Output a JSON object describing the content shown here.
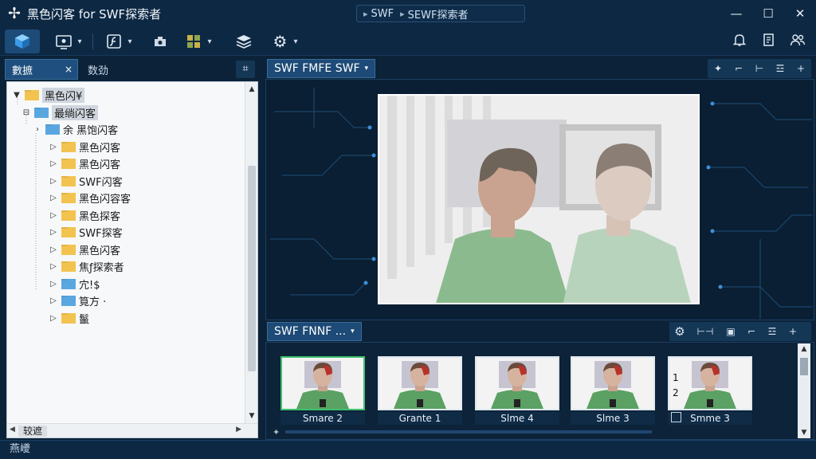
{
  "app": {
    "title": "黑色闪客 for SWF探索者"
  },
  "breadcrumb": {
    "items": [
      "SWF",
      "SEWF探索者"
    ]
  },
  "window_controls": [
    "minimize-icon",
    "maximize-icon",
    "close-icon"
  ],
  "toolbar": {
    "buttons": [
      "cube-icon",
      "screen-capture-icon",
      "flash-file-icon",
      "plugin-icon",
      "grid-icon",
      "layers-icon",
      "gear-icon"
    ],
    "right_buttons": [
      "bell-icon",
      "document-icon",
      "users-icon"
    ]
  },
  "left_panel": {
    "tabs": [
      {
        "label": "數摭",
        "close": "×"
      },
      {
        "label": "数劲"
      }
    ],
    "pin_label": "⌗",
    "tree": [
      {
        "label": "黑色闪¥",
        "depth": 0,
        "toggle": "▼",
        "folder": "yellow",
        "selected": true
      },
      {
        "label": "最绱闪客",
        "depth": 1,
        "toggle": "⊟",
        "folder": "blue",
        "selected": true
      },
      {
        "label": "余 黑饱闪客",
        "depth": 2,
        "toggle": "›",
        "folder": "blue"
      },
      {
        "label": "黑色闪客",
        "depth": 3,
        "toggle": "▷",
        "folder": "yellow"
      },
      {
        "label": "黑色闪客",
        "depth": 3,
        "toggle": "▷",
        "folder": "yellow"
      },
      {
        "label": "SWF闪客",
        "depth": 3,
        "toggle": "▷",
        "folder": "yellow"
      },
      {
        "label": "黑色闪容客",
        "depth": 3,
        "toggle": "▷",
        "folder": "yellow"
      },
      {
        "label": "黑色探客",
        "depth": 3,
        "toggle": "▷",
        "folder": "yellow"
      },
      {
        "label": "SWF探客",
        "depth": 3,
        "toggle": "▷",
        "folder": "yellow"
      },
      {
        "label": "黑色闪客",
        "depth": 3,
        "toggle": "▷",
        "folder": "yellow"
      },
      {
        "label": "焦ƒ探索者",
        "depth": 3,
        "toggle": "▷",
        "folder": "yellow"
      },
      {
        "label": "宂!$",
        "depth": 3,
        "toggle": "▷",
        "folder": "blue"
      },
      {
        "label": "筧方 ·",
        "depth": 3,
        "toggle": "▷",
        "folder": "blue"
      },
      {
        "label": "鬣",
        "depth": 3,
        "toggle": "▷",
        "folder": "yellow"
      }
    ],
    "bottom_chip": "较遮"
  },
  "preview_panel": {
    "tab_label": "SWF FMFE SWF",
    "tools": [
      "✦",
      "⌐",
      "⊢",
      "☲",
      "+"
    ]
  },
  "thumbnail_panel": {
    "tab_label": "SWF FNNF ...",
    "tools": [
      "gear-icon",
      "⊢⊣",
      "▣",
      "⌐",
      "☲",
      "+"
    ],
    "thumbnails": [
      {
        "caption": "Smare 2",
        "selected": true
      },
      {
        "caption": "Grante 1"
      },
      {
        "caption": "Slme 4"
      },
      {
        "caption": "Slme 3"
      },
      {
        "caption": "Smme 3",
        "numbers": [
          "1",
          "2"
        ],
        "checkbox": true
      }
    ]
  },
  "status_bar": {
    "text": "燕巙"
  },
  "colors": {
    "window_bg": "#0b2238",
    "accent": "#1d4b78",
    "selection_green": "#3fbf6c",
    "folder_yellow": "#f2c34e",
    "folder_blue": "#5aa7e0"
  }
}
